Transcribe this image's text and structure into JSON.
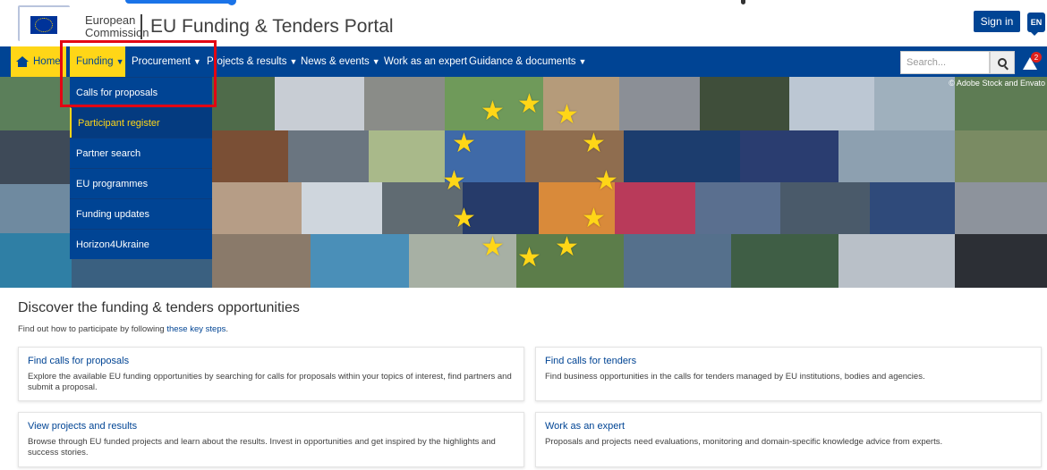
{
  "header": {
    "org_line1": "European",
    "org_line2": "Commission",
    "portal_title": "EU Funding & Tenders Portal",
    "sign_in": "Sign in",
    "language": "EN"
  },
  "nav": {
    "home": "Home",
    "funding": "Funding",
    "procurement": "Procurement",
    "projects": "Projects & results",
    "news": "News & events",
    "expert": "Work as an expert",
    "guidance": "Guidance & documents",
    "search_placeholder": "Search...",
    "notification_count": "2"
  },
  "dropdown": {
    "items": [
      {
        "label": "Calls for proposals"
      },
      {
        "label": "Participant register"
      },
      {
        "label": "Partner search"
      },
      {
        "label": "EU programmes"
      },
      {
        "label": "Funding updates"
      },
      {
        "label": "Horizon4Ukraine"
      }
    ]
  },
  "hero": {
    "credit": "© Adobe Stock and Envato"
  },
  "main": {
    "title": "Discover the funding & tenders opportunities",
    "subtitle_prefix": "Find out how to participate by following ",
    "subtitle_link": "these key steps",
    "subtitle_suffix": ".",
    "cards": [
      {
        "title": "Find calls for proposals",
        "text": "Explore the available EU funding opportunities by searching for calls for proposals within your topics of interest, find partners and submit a proposal."
      },
      {
        "title": "Find calls for tenders",
        "text": "Find business opportunities in the calls for tenders managed by EU institutions, bodies and agencies."
      },
      {
        "title": "View projects and results",
        "text": "Browse through EU funded projects and learn about the results. Invest in opportunities and get inspired by the highlights and success stories."
      },
      {
        "title": "Work as an expert",
        "text": "Proposals and projects need evaluations, monitoring and domain-specific knowledge advice from experts."
      }
    ]
  },
  "colors": {
    "primary_blue": "#004494",
    "accent_yellow": "#ffd617",
    "highlight_red": "#e30613"
  }
}
